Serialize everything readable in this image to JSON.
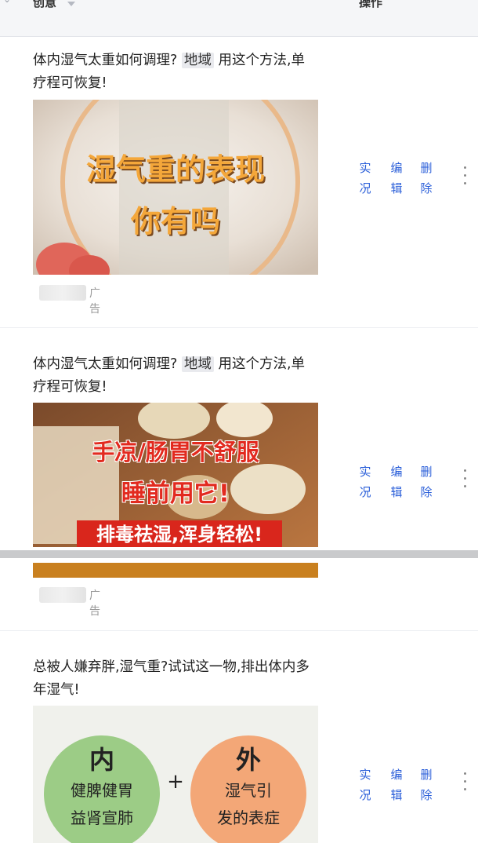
{
  "header": {
    "col_creative": "创意",
    "col_action": "操作"
  },
  "rows": [
    {
      "title_a": "体内湿气太重如何调理?",
      "tag": "地域",
      "title_b": "用这个方法,单疗程可恢复!",
      "image_text_1": "湿气重的表现",
      "image_text_2": "你有吗",
      "ad_label": "广告",
      "actions": {
        "a1": "实",
        "a2": "况",
        "b1": "编",
        "b2": "辑",
        "c1": "删",
        "c2": "除"
      }
    },
    {
      "title_a": "体内湿气太重如何调理?",
      "tag": "地域",
      "title_b": "用这个方法,单疗程可恢复!",
      "image_text_1": "手凉/肠胃不舒服",
      "image_text_2": "睡前用它!",
      "image_text_3": "排毒祛湿,浑身轻松!",
      "ad_label": "广告",
      "actions": {
        "a1": "实",
        "a2": "况",
        "b1": "编",
        "b2": "辑",
        "c1": "删",
        "c2": "除"
      }
    },
    {
      "title_full": "总被人嫌弃胖,湿气重?试试这一物,排出体内多年湿气!",
      "circle_left_head": "内",
      "circle_left_l1": "健脾健胃",
      "circle_left_l2": "益肾宣肺",
      "plus": "+",
      "circle_right_head": "外",
      "circle_right_l1": "湿气引",
      "circle_right_l2": "发的表症",
      "actions": {
        "a1": "实",
        "a2": "况",
        "b1": "编",
        "b2": "辑",
        "c1": "删",
        "c2": "除"
      }
    }
  ],
  "colors": {
    "link": "#2b5fd9",
    "overlay_orange": "#f4a73a",
    "overlay_red": "#d9261c"
  }
}
